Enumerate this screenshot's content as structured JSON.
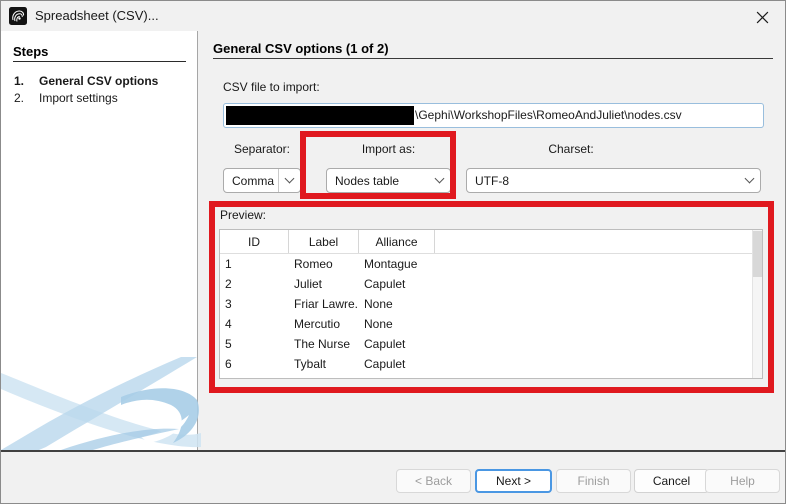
{
  "window": {
    "title": "Spreadsheet (CSV)..."
  },
  "colors": {
    "annotation_red": "#e0191f",
    "default_button_blue": "#4a97e3",
    "field_focus_blue": "#99bedd",
    "watermark_blue": "#bcd8ec"
  },
  "sidebar": {
    "header": "Steps",
    "steps": [
      {
        "number": "1.",
        "label": "General CSV options"
      },
      {
        "number": "2.",
        "label": "Import settings"
      }
    ]
  },
  "main": {
    "header": "General CSV options (1 of 2)",
    "file_section": {
      "label": "CSV file to import:",
      "path_visible": "\\Gephi\\WorkshopFiles\\RomeoAndJuliet\\nodes.csv"
    },
    "separator": {
      "label": "Separator:",
      "value": "Comma"
    },
    "import_as": {
      "label": "Import as:",
      "value": "Nodes table"
    },
    "charset": {
      "label": "Charset:",
      "value": "UTF-8"
    },
    "preview": {
      "label": "Preview:",
      "columns": [
        "ID",
        "Label",
        "Alliance"
      ],
      "rows": [
        {
          "id": "1",
          "label": "Romeo",
          "alliance": "Montague"
        },
        {
          "id": "2",
          "label": "Juliet",
          "alliance": "Capulet"
        },
        {
          "id": "3",
          "label": "Friar Lawre...",
          "alliance": "None"
        },
        {
          "id": "4",
          "label": "Mercutio",
          "alliance": "None"
        },
        {
          "id": "5",
          "label": "The Nurse",
          "alliance": "Capulet"
        },
        {
          "id": "6",
          "label": "Tybalt",
          "alliance": "Capulet"
        }
      ]
    }
  },
  "buttons": [
    {
      "label": "< Back",
      "enabled": false
    },
    {
      "label": "Next >",
      "enabled": true,
      "default": true
    },
    {
      "label": "Finish",
      "enabled": false
    },
    {
      "label": "Cancel",
      "enabled": true
    },
    {
      "label": "Help",
      "enabled": false
    }
  ]
}
